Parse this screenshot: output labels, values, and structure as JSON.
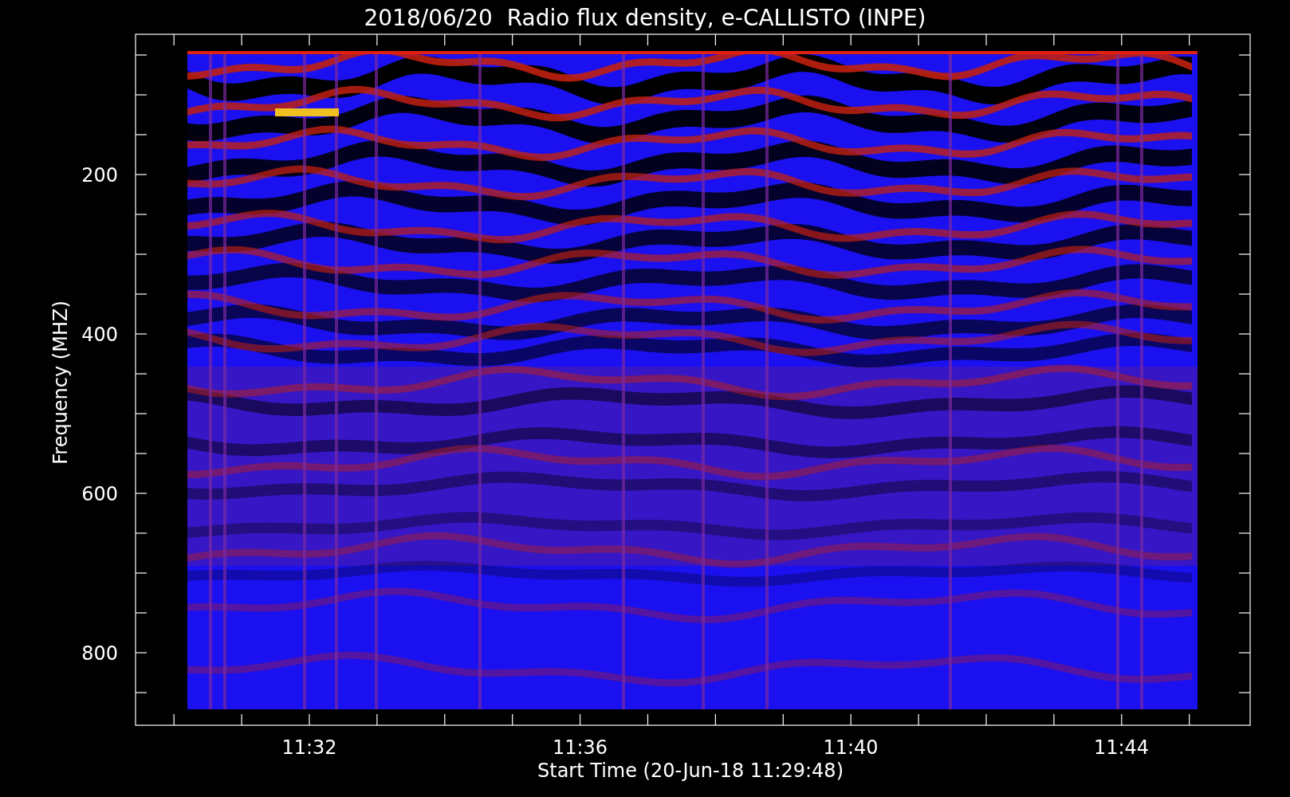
{
  "title": "2018/06/20  Radio flux density, e-CALLISTO (INPE)",
  "y_axis": {
    "label": "Frequency (MHZ)",
    "ticks": [
      "200",
      "400",
      "600",
      "800"
    ]
  },
  "x_axis": {
    "label": "Start Time (20-Jun-18 11:29:48)",
    "ticks": [
      "11:32",
      "11:36",
      "11:40",
      "11:44"
    ]
  }
}
